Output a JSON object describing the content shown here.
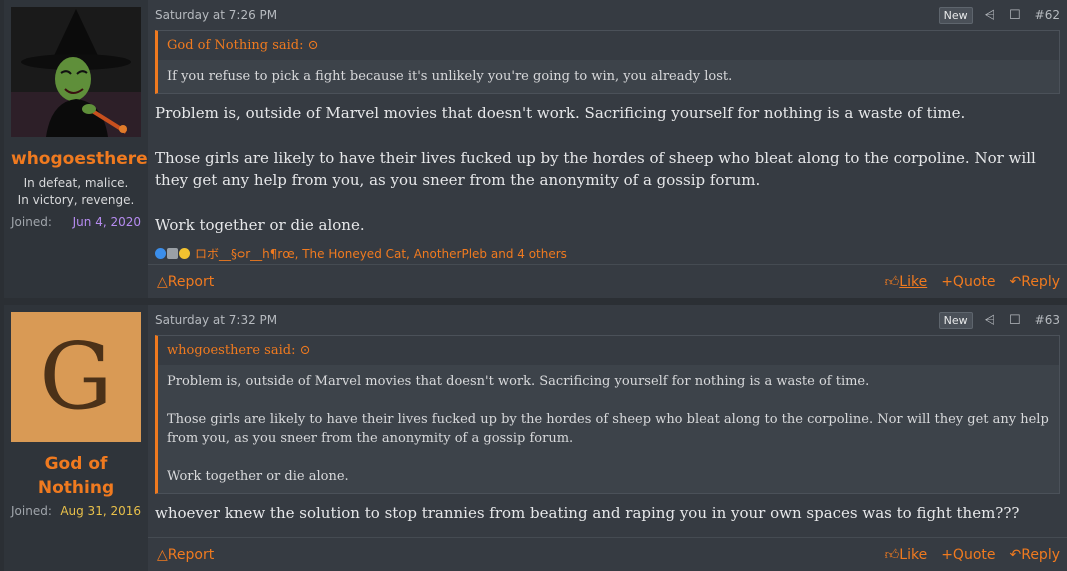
{
  "posts": [
    {
      "username": "whogoesthere",
      "user_title": "In defeat, malice. In victory, revenge.",
      "joined_label": "Joined:",
      "joined_date": "Jun 4, 2020",
      "date": "Saturday at 7:26 PM",
      "new_badge": "New",
      "post_number": "#62",
      "quote_author": "God of Nothing said:",
      "quote_paragraphs": [
        "If you refuse to pick a fight because it's unlikely you're going to win, you already lost."
      ],
      "message_paragraphs": [
        "Problem is, outside of Marvel movies that doesn't work. Sacrificing yourself for nothing is a waste of time.",
        "Those girls are likely to have their lives fucked up by the hordes of sheep who bleat along to the corpoline. Nor will they get any help from you, as you sneer from the anonymity of a gossip forum.",
        "Work together or die alone."
      ],
      "reactions_text": "ロボ__§ᴑr__h¶rœ, The Honeyed Cat, AnotherPleb and 4 others",
      "report_label": "Report",
      "like_label": "Like",
      "quote_label": "Quote",
      "reply_label": "Reply"
    },
    {
      "username": "God of Nothing",
      "avatar_letter": "G",
      "joined_label": "Joined:",
      "joined_date": "Aug 31, 2016",
      "date": "Saturday at 7:32 PM",
      "new_badge": "New",
      "post_number": "#63",
      "quote_author": "whogoesthere said:",
      "quote_paragraphs": [
        "Problem is, outside of Marvel movies that doesn't work. Sacrificing yourself for nothing is a waste of time.",
        "Those girls are likely to have their lives fucked up by the hordes of sheep who bleat along to the corpoline. Nor will they get any help from you, as you sneer from the anonymity of a gossip forum.",
        "Work together or die alone."
      ],
      "message_paragraphs": [
        "whoever knew the solution to stop trannies from beating and raping you in your own spaces was to fight them???"
      ],
      "report_label": "Report",
      "like_label": "Like",
      "quote_label": "Quote",
      "reply_label": "Reply"
    }
  ],
  "colors": {
    "accent": "#f07a1f",
    "joined_1": "#b68cf0",
    "joined_2": "#e8c04a"
  }
}
